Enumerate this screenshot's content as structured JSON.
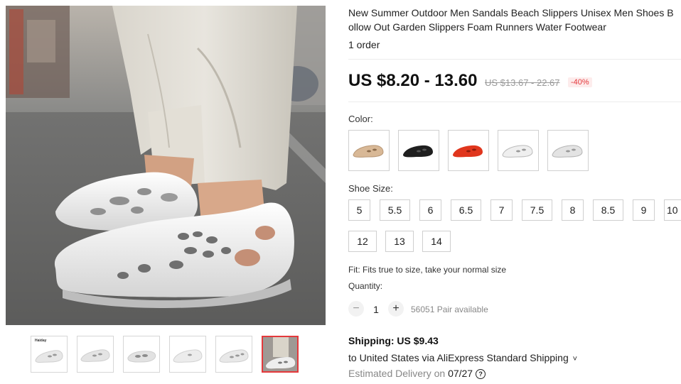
{
  "product": {
    "title_line1": "New Summer Outdoor Men Sandals Beach Slippers Unisex Men Shoes B",
    "title_line2": "ollow Out Garden Slippers Foam Runners Water Footwear",
    "orders": "1 order"
  },
  "gallery": {
    "main_image": "white-foam-runner-photo",
    "thumbnails": [
      {
        "name": "thumb-1",
        "brand": "Haiday",
        "color": "#eeeeee"
      },
      {
        "name": "thumb-2",
        "color": "#ededed"
      },
      {
        "name": "thumb-3",
        "color": "#e9e9e9"
      },
      {
        "name": "thumb-4",
        "color": "#efefef"
      },
      {
        "name": "thumb-5",
        "color": "#ececec"
      },
      {
        "name": "thumb-6",
        "color": "#b7b2ad",
        "active": true
      }
    ]
  },
  "price": {
    "current": "US $8.20 - 13.60",
    "original": "US $13.67 - 22.67",
    "discount": "-40%"
  },
  "color": {
    "label": "Color:",
    "options": [
      {
        "name": "khaki",
        "hex": "#d8b896"
      },
      {
        "name": "black",
        "hex": "#1f1f1f"
      },
      {
        "name": "red",
        "hex": "#e0361d"
      },
      {
        "name": "white",
        "hex": "#efefef"
      },
      {
        "name": "light-grey",
        "hex": "#e3e3e3"
      }
    ]
  },
  "size": {
    "label": "Shoe Size:",
    "options": [
      "5",
      "5.5",
      "6",
      "6.5",
      "7",
      "7.5",
      "8",
      "8.5",
      "9",
      "10",
      "12",
      "13",
      "14"
    ]
  },
  "fit": "Fit: Fits true to size, take your normal size",
  "quantity": {
    "label": "Quantity:",
    "minus": "−",
    "plus": "+",
    "value": "1",
    "available": "56051 Pair available"
  },
  "shipping": {
    "title": "Shipping: US $9.43",
    "to": "to United States via AliExpress Standard Shipping",
    "chevron": "˅",
    "estimated_label": "Estimated Delivery on ",
    "estimated_date": "07/27",
    "help": "?"
  },
  "colors": {
    "accent": "#e4393c",
    "discount_bg": "#fdecec"
  }
}
